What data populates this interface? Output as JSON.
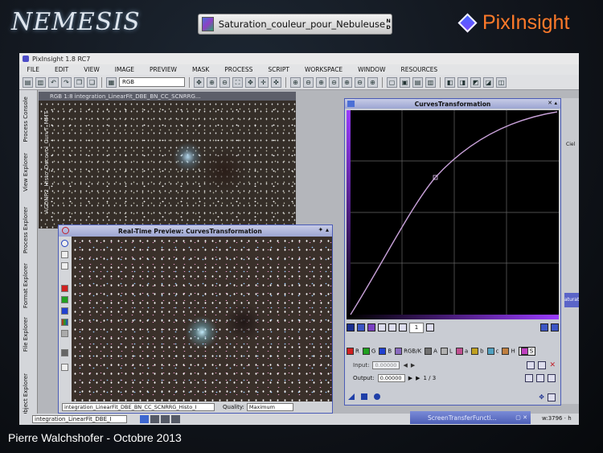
{
  "slide": {
    "logo_left": "NEMESIS",
    "logo_right": "PixInsight",
    "process_chip": {
      "label": "Saturation_couleur_pour_Nebuleuse",
      "n": "N",
      "d": "D"
    },
    "footer": "Pierre Walchshofer - Octobre 2013"
  },
  "app": {
    "title": "PixInsight 1.8 RC7",
    "menu": [
      "FILE",
      "EDIT",
      "VIEW",
      "IMAGE",
      "PREVIEW",
      "MASK",
      "PROCESS",
      "SCRIPT",
      "WORKSPACE",
      "WINDOW",
      "RESOURCES"
    ],
    "toolbar_rgb": "RGB",
    "sidebar_tabs": [
      "Process Console",
      "View Explorer",
      "Process Explorer",
      "Format Explorer",
      "File Explorer",
      "Object Explorer"
    ],
    "image_window_title": "RGB 1:8 integration_LinearFit_DBE_BN_CC_SCNRRG...",
    "image_window_side_label": "ACDNR2_Histo_Decovol_CurvT_MMT",
    "preview": {
      "title": "Real-Time Preview: CurvesTransformation",
      "target": "integration_LinearFit_DBE_BN_CC_SCNRRG_Histo_I",
      "quality_label": "Quality:",
      "quality_value": "Maximum"
    },
    "curves": {
      "title": "CurvesTransformation",
      "zoom_value": "1",
      "channels": [
        {
          "label": "R",
          "color": "#d02020"
        },
        {
          "label": "G",
          "color": "#20a020"
        },
        {
          "label": "B",
          "color": "#2040d0"
        },
        {
          "label": "RGB/K",
          "color": "#8a6bc0"
        },
        {
          "label": "A",
          "color": "#707070"
        },
        {
          "label": "L",
          "color": "#b0b0b0"
        },
        {
          "label": "a",
          "color": "#c05090"
        },
        {
          "label": "b",
          "color": "#c0a020"
        },
        {
          "label": "c",
          "color": "#50a0c0"
        },
        {
          "label": "H",
          "color": "#c08040"
        },
        {
          "label": "S",
          "color": "#c040c0"
        }
      ],
      "input_label": "Input:",
      "input_value": "0.00000",
      "output_label": "Output:",
      "output_value": "0.00000",
      "point_counter": "1 / 3",
      "curve_color": "#c7a0d8"
    },
    "status": {
      "view_select": "integration_LinearFit_DBE_I",
      "stf_title": "ScreenTransferFuncti...",
      "coord": "w:3796 · h"
    },
    "violet_tab": "aturation",
    "right_label": "Ciel"
  }
}
